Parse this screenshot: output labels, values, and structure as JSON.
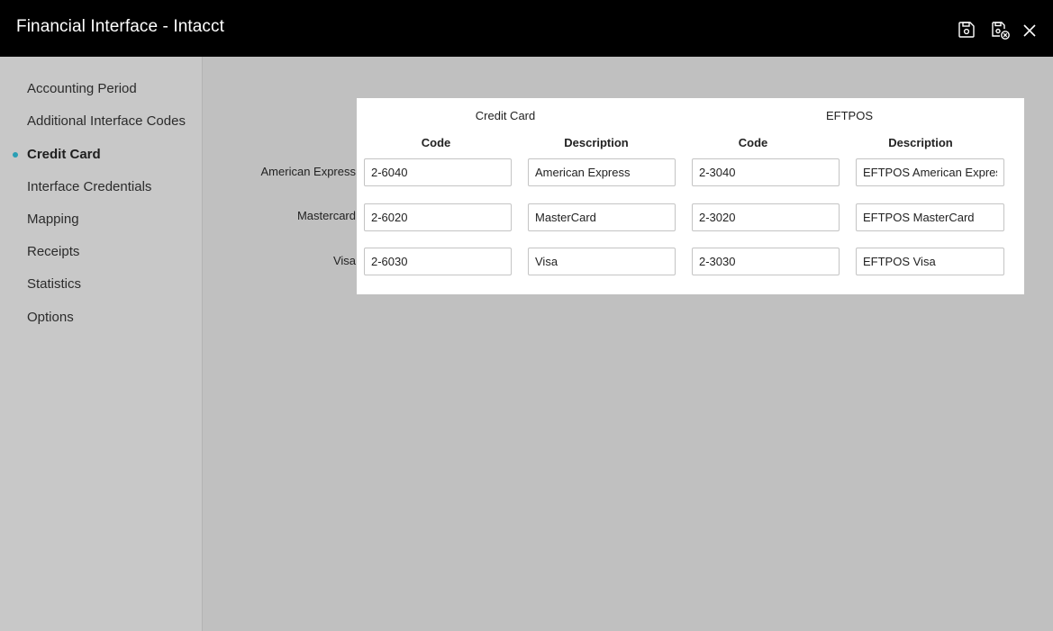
{
  "window": {
    "title": "Financial Interface - Intacct",
    "save_icon": "save-icon",
    "save_close_icon": "save-close-icon",
    "close_icon": "close-icon"
  },
  "sidebar": {
    "items": [
      {
        "label": "Accounting Period",
        "active": false
      },
      {
        "label": "Additional Interface Codes",
        "active": false
      },
      {
        "label": "Credit Card",
        "active": true
      },
      {
        "label": "Interface Credentials",
        "active": false
      },
      {
        "label": "Mapping",
        "active": false
      },
      {
        "label": "Receipts",
        "active": false
      },
      {
        "label": "Statistics",
        "active": false
      },
      {
        "label": "Options",
        "active": false
      }
    ],
    "active_color": "#2a9fb4"
  },
  "table": {
    "groups": [
      "Credit Card",
      "EFTPOS"
    ],
    "columns": [
      "Code",
      "Description",
      "Code",
      "Description"
    ],
    "rows": [
      {
        "label": "American Express",
        "cc_code": "2-6040",
        "cc_desc": "American Express",
        "eft_code": "2-3040",
        "eft_desc": "EFTPOS American Express"
      },
      {
        "label": "Mastercard",
        "cc_code": "2-6020",
        "cc_desc": "MasterCard",
        "eft_code": "2-3020",
        "eft_desc": "EFTPOS MasterCard"
      },
      {
        "label": "Visa",
        "cc_code": "2-6030",
        "cc_desc": "Visa",
        "eft_code": "2-3030",
        "eft_desc": "EFTPOS Visa"
      }
    ]
  }
}
